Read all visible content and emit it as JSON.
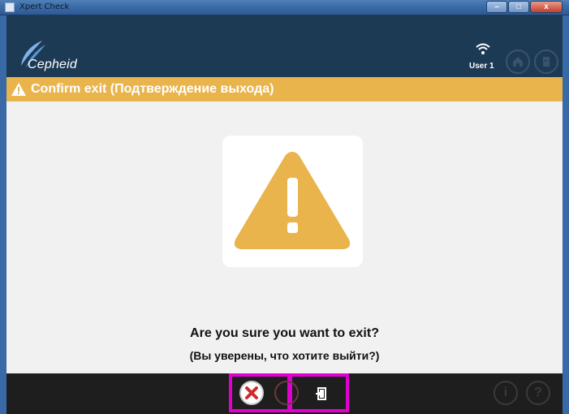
{
  "window": {
    "title": "Xpert Check",
    "controls": {
      "minimize": "–",
      "maximize": "□",
      "close": "x"
    }
  },
  "header": {
    "brand": "Cepheid",
    "user": "User 1",
    "icons": [
      "wifi-icon",
      "home-icon",
      "exit-icon"
    ]
  },
  "banner": {
    "title": "Confirm exit (Подтверждение выхода)",
    "color": "#e9b44c"
  },
  "dialog": {
    "question_en": "Are you sure you want to exit?",
    "question_ru": "(Вы уверены, что хотите выйти?)"
  },
  "footer": {
    "cancel_icon": "x-circle-icon",
    "confirm_icon": "door-exit-icon",
    "info_label": "i",
    "help_label": "?"
  },
  "colors": {
    "header_bg": "#1d3a55",
    "content_bg": "#f1f1f1",
    "footer_bg": "#1e1e1e",
    "warning": "#e9b44c",
    "cancel_red": "#d02b2b",
    "highlight": "#e000d0"
  }
}
